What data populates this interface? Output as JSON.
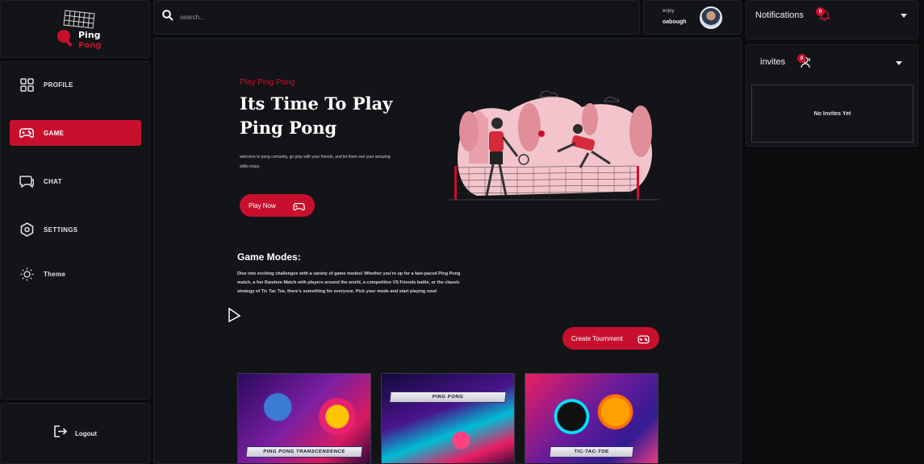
{
  "brand": {
    "line1": "Ping",
    "line2": "Pong"
  },
  "sidebar": {
    "items": [
      {
        "label": "PROFILE",
        "icon": "grid-icon"
      },
      {
        "label": "GAME",
        "icon": "gamepad-icon",
        "active": true
      },
      {
        "label": "CHAT",
        "icon": "chat-icon"
      },
      {
        "label": "SETTINGS",
        "icon": "hexagon-settings-icon"
      },
      {
        "label": "Theme",
        "icon": "sun-icon"
      }
    ],
    "logout_label": "Logout"
  },
  "search": {
    "placeholder": "search..."
  },
  "user": {
    "greeting": "enjoy",
    "name": "oabough"
  },
  "hero": {
    "kicker": "Play Ping Pong",
    "title": "Its Time To Play Ping Pong",
    "description": "welcome to pong comunity, go play with your friends, and let them see your amazing skills enjoy.",
    "play_label": "Play Now"
  },
  "modes": {
    "title": "Game Modes:",
    "description": "Dive into exciting challenges with a variety of game modes! Whether you're up for a fast-paced Ping Pong match, a fun Random Match with players around the world, a competitive VS Friends battle, or the classic strategy of Tic Tac Toe, there's something for everyone. Pick your mode and start playing now!",
    "tournament_label": "Create Tournment"
  },
  "cards": [
    {
      "banner": "PING PONG TRANSCENDENCE"
    },
    {
      "banner": "PING PONG"
    },
    {
      "banner": "TIC-TAC-TOE"
    }
  ],
  "notifications": {
    "title": "Notifications",
    "count": "0"
  },
  "invites": {
    "title": "invites",
    "count": "0",
    "empty_text": "No Invites Yet"
  },
  "colors": {
    "accent": "#c8102e",
    "background": "#0b0c0e",
    "panel": "#121417"
  }
}
